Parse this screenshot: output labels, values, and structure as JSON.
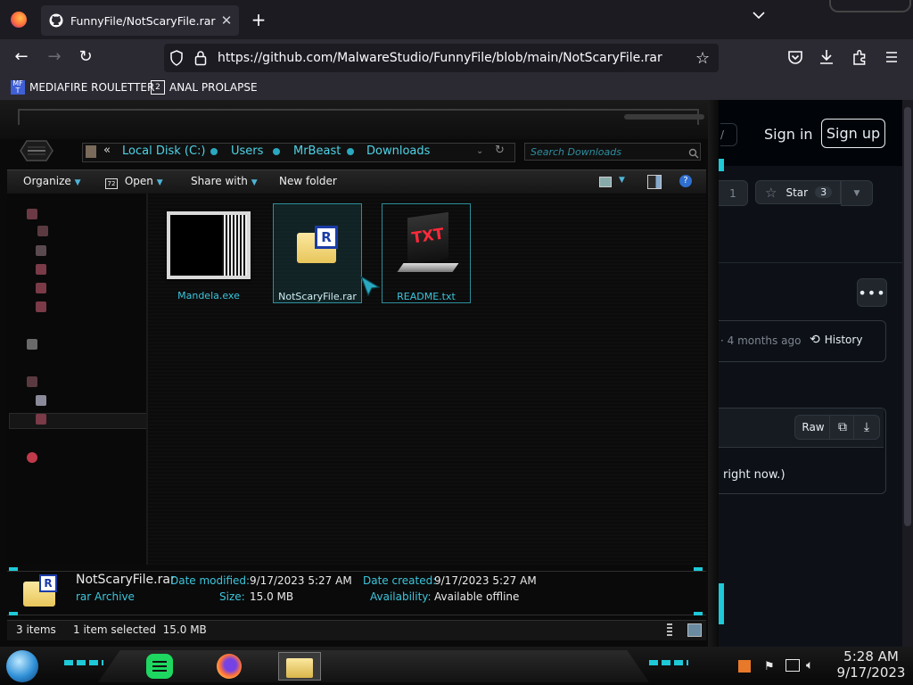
{
  "browser": {
    "tab_title": "FunnyFile/NotScaryFile.rar at m",
    "url": "https://github.com/MalwareStudio/FunnyFile/blob/main/NotScaryFile.rar",
    "bookmarks": [
      {
        "label": "MEDIAFIRE ROULETTER",
        "icon_text": "MF T"
      },
      {
        "label": "ANAL PROLAPSE",
        "icon_text": "2"
      }
    ]
  },
  "github": {
    "sign_in": "Sign in",
    "sign_up": "Sign up",
    "star_label": "Star",
    "star_count": "3",
    "fork_count": "1",
    "commit_age": "· 4 months ago",
    "history": "History",
    "raw": "Raw",
    "blob_text": "right now.)"
  },
  "explorer": {
    "breadcrumb": [
      "Local Disk (C:)",
      "Users",
      "MrBeast",
      "Downloads"
    ],
    "search_placeholder": "Search Downloads",
    "toolbar": {
      "organize": "Organize",
      "open": "Open",
      "share_with": "Share with",
      "new_folder": "New folder"
    },
    "files": [
      {
        "name": "Mandela.exe",
        "selected": false
      },
      {
        "name": "NotScaryFile.rar",
        "selected": true
      },
      {
        "name": "README.txt",
        "selected": false
      }
    ],
    "txt_icon_text": "TXT",
    "rar_icon_text": "R",
    "details": {
      "name": "NotScaryFile.rar",
      "type": "rar Archive",
      "date_modified_label": "Date modified:",
      "date_modified": "9/17/2023 5:27 AM",
      "size_label": "Size:",
      "size": "15.0 MB",
      "date_created_label": "Date created:",
      "date_created": "9/17/2023 5:27 AM",
      "availability_label": "Availability:",
      "availability": "Available offline"
    },
    "status": {
      "items": "3 items",
      "selected": "1 item selected  15.0 MB"
    }
  },
  "taskbar": {
    "time": "5:28 AM",
    "date": "9/17/2023"
  },
  "colors": {
    "accent_cyan": "#3bc6dc",
    "github_bg": "#0d1117",
    "firefox_toolbar": "#2b2a33"
  }
}
